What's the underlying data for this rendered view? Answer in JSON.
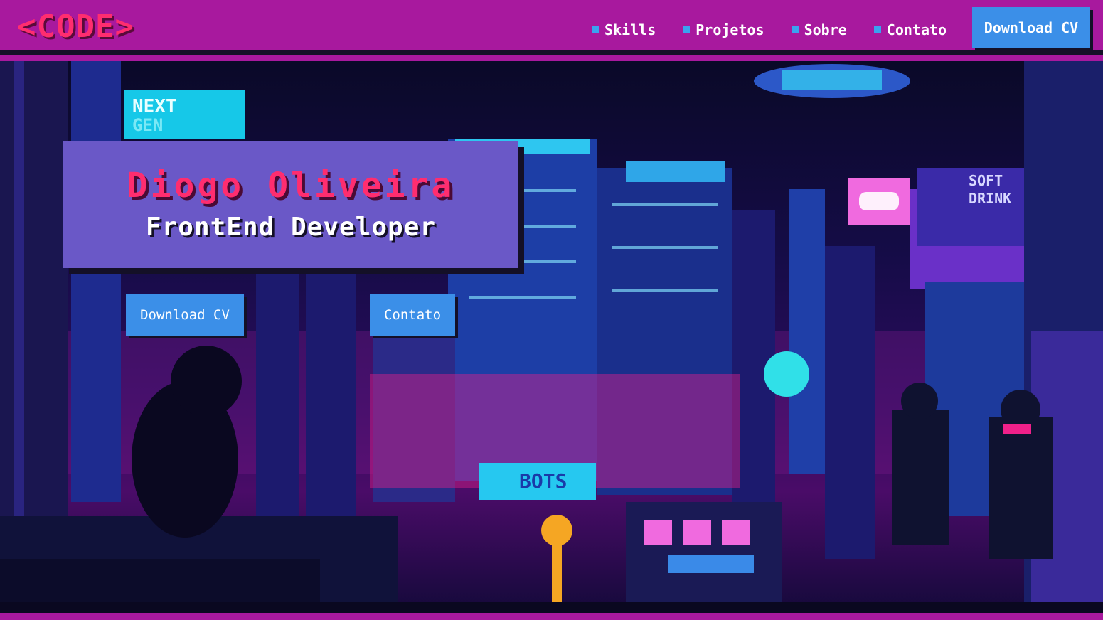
{
  "header": {
    "logo": "<CODE>",
    "nav": [
      {
        "label": "Skills"
      },
      {
        "label": "Projetos"
      },
      {
        "label": "Sobre"
      },
      {
        "label": "Contato"
      }
    ],
    "cv_button": "Download CV"
  },
  "hero": {
    "name": "Diogo Oliveira",
    "role": "FrontEnd Developer",
    "buttons": {
      "download_cv": "Download CV",
      "contact": "Contato"
    },
    "signs": {
      "next": "NEXT",
      "gen": "GEN",
      "bots": "BOTS",
      "soft": "SOFT",
      "drink": "DRINK"
    }
  },
  "colors": {
    "header_bg": "#a8199e",
    "accent_pink": "#ff2d6f",
    "button_blue": "#3b8fe8",
    "card_purple": "#6a58c7",
    "dark": "#141027"
  }
}
